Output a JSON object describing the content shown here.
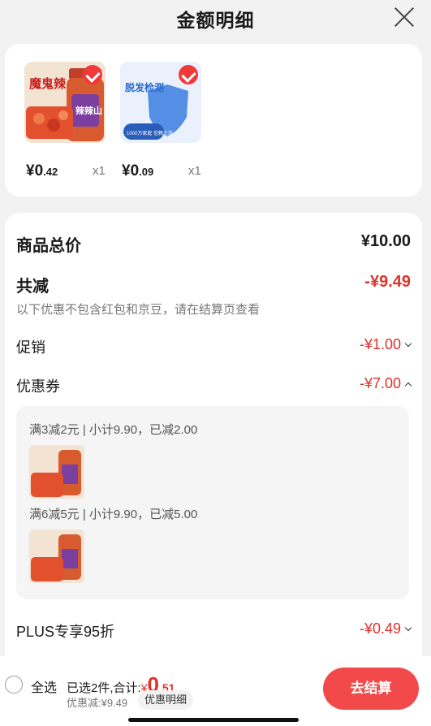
{
  "header": {
    "title": "金额明细"
  },
  "products": [
    {
      "price_int": "¥0",
      "price_dec": ".42",
      "qty": "x1",
      "img_text": "魔鬼辣",
      "img_sub": "辣辣山"
    },
    {
      "price_int": "¥0",
      "price_dec": ".09",
      "qty": "x1",
      "img_text": "脱发检测",
      "img_sub": "1000万家庭 信赖之选"
    }
  ],
  "summary": {
    "total_label": "商品总价",
    "total_value": "¥10.00",
    "reduce_label": "共减",
    "reduce_value": "-¥9.49",
    "note": "以下优惠不包含红包和京豆，请在结算页查看",
    "promo_label": "促销",
    "promo_value": "-¥1.00",
    "coupon_label": "优惠券",
    "coupon_value": "-¥7.00",
    "coupon_lines": [
      "满3减2元 | 小计9.90，已减2.00",
      "满6减5元 | 小计9.90，已减5.00"
    ],
    "plus_label": "PLUS专享95折",
    "plus_value": "-¥0.49"
  },
  "bottom": {
    "select_all": "全选",
    "summary_text": "已选2件,合计:",
    "yen": "¥",
    "amount_int": "0",
    "amount_dec": ".51",
    "discount_text": "优惠减:¥9.49",
    "detail_button": "优惠明细",
    "pay_button": "去结算"
  },
  "colors": {
    "accent": "#e0312b",
    "button": "#f24a4a"
  }
}
